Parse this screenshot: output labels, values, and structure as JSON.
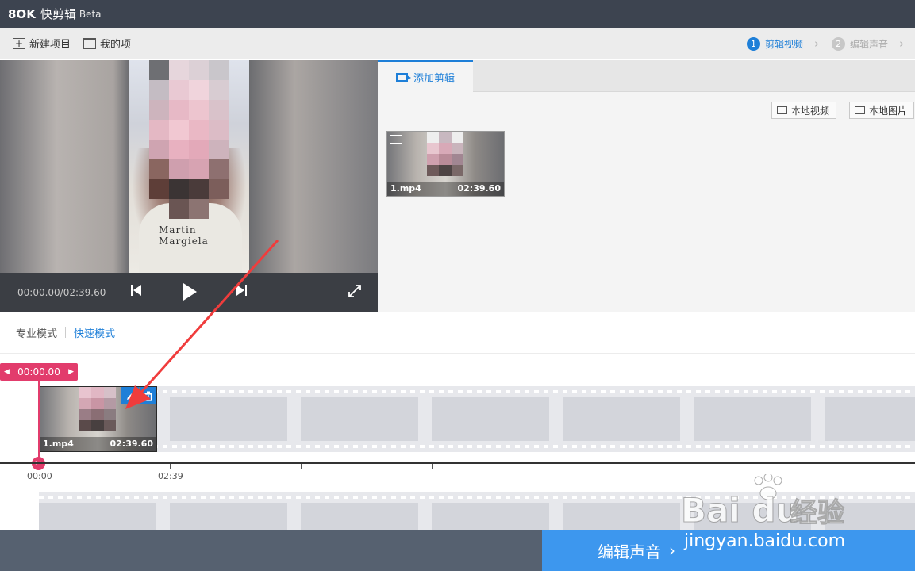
{
  "window": {
    "logo": "8OK",
    "title": "快剪辑",
    "beta": "Beta"
  },
  "toolbar": {
    "new_project": "新建项目",
    "my_projects": "我的项"
  },
  "steps": [
    {
      "num": "1",
      "label": "剪辑视频"
    },
    {
      "num": "2",
      "label": "编辑声音"
    }
  ],
  "preview": {
    "time": "00:00.00/02:39.60",
    "shirt_text": "Martin Margiela"
  },
  "media": {
    "tab_label": "添加剪辑",
    "local_video": "本地视频",
    "local_image": "本地图片",
    "clip": {
      "name": "1.mp4",
      "duration": "02:39.60"
    }
  },
  "modes": {
    "pro": "专业模式",
    "quick": "快速模式"
  },
  "timeline": {
    "playhead_time": "00:00.00",
    "clip": {
      "name": "1.mp4",
      "duration": "02:39.60"
    },
    "ruler_labels": [
      "00:00",
      "02:39"
    ]
  },
  "bottom": {
    "next_button": "编辑声音"
  },
  "watermark": {
    "url": "jingyan.baidu.com"
  },
  "colors": {
    "accent": "#1e7fd8",
    "playhead": "#e23c6c",
    "next_button": "#3d97ee",
    "annotation_arrow": "#f03c3c"
  }
}
